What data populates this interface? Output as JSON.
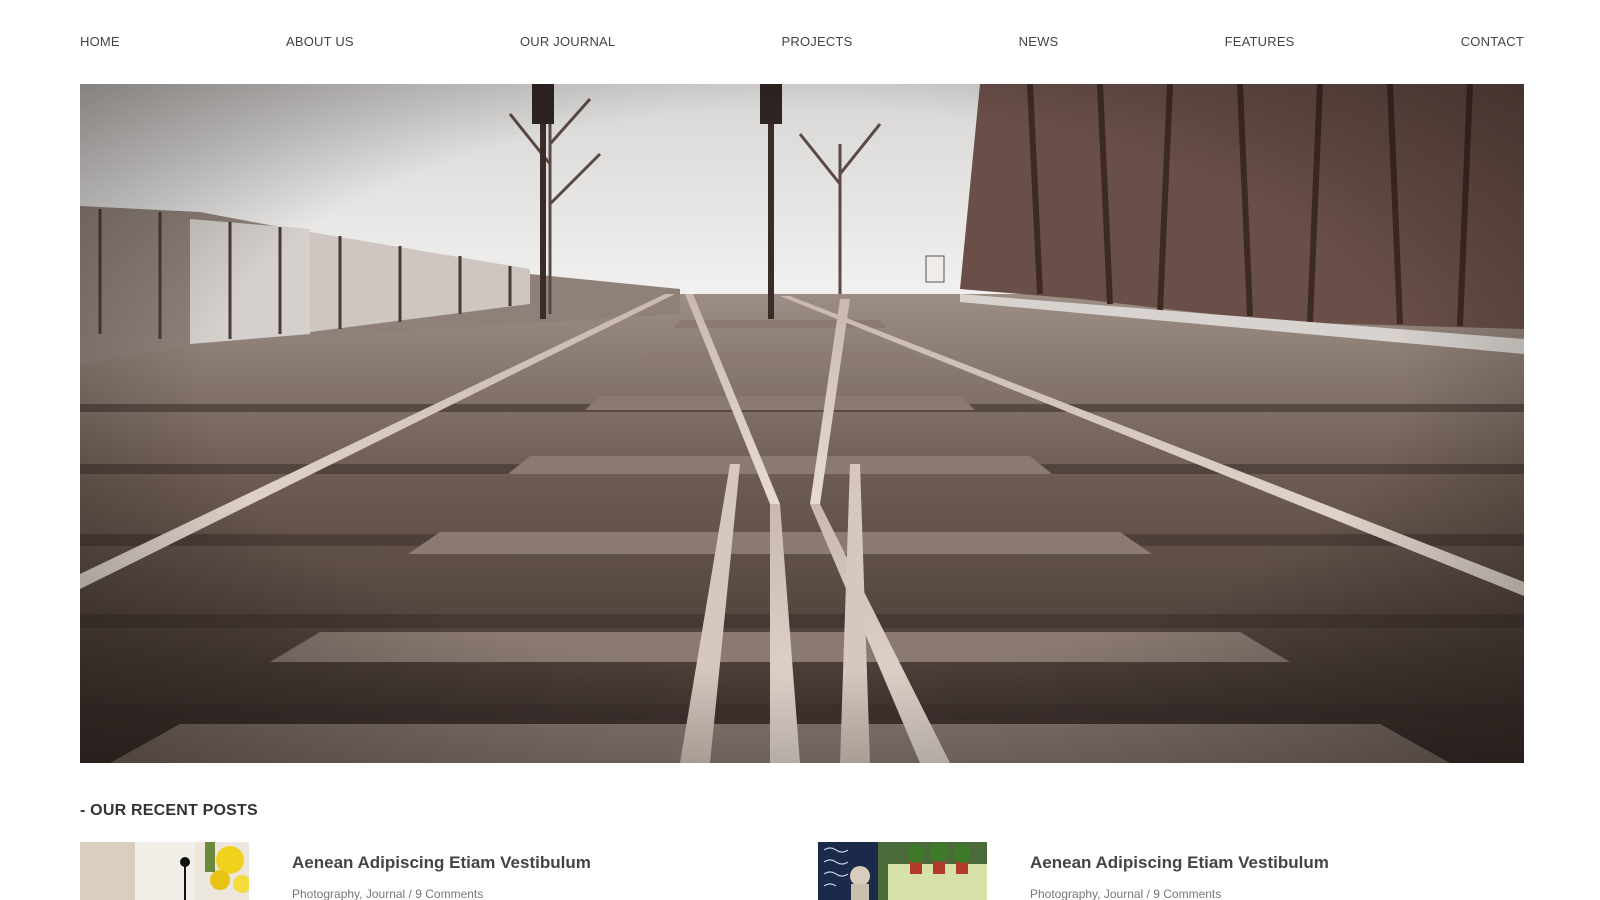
{
  "nav": {
    "items": [
      {
        "label": "HOME"
      },
      {
        "label": "ABOUT US"
      },
      {
        "label": "OUR JOURNAL"
      },
      {
        "label": "PROJECTS"
      },
      {
        "label": "NEWS"
      },
      {
        "label": "FEATURES"
      },
      {
        "label": "CONTACT"
      }
    ]
  },
  "recent": {
    "title": "- OUR RECENT POSTS",
    "posts": [
      {
        "title": "Aenean Adipiscing Etiam Vestibulum",
        "category_1": "Photography",
        "separator": ",",
        "category_2": "Journal",
        "slash": " / ",
        "comments": "9 Comments"
      },
      {
        "title": "Aenean Adipiscing Etiam Vestibulum",
        "category_1": "Photography",
        "separator": ",",
        "category_2": "Journal",
        "slash": " / ",
        "comments": "9 Comments"
      }
    ]
  },
  "colors": {
    "text": "#444444",
    "meta": "#777777",
    "background": "#ffffff"
  }
}
